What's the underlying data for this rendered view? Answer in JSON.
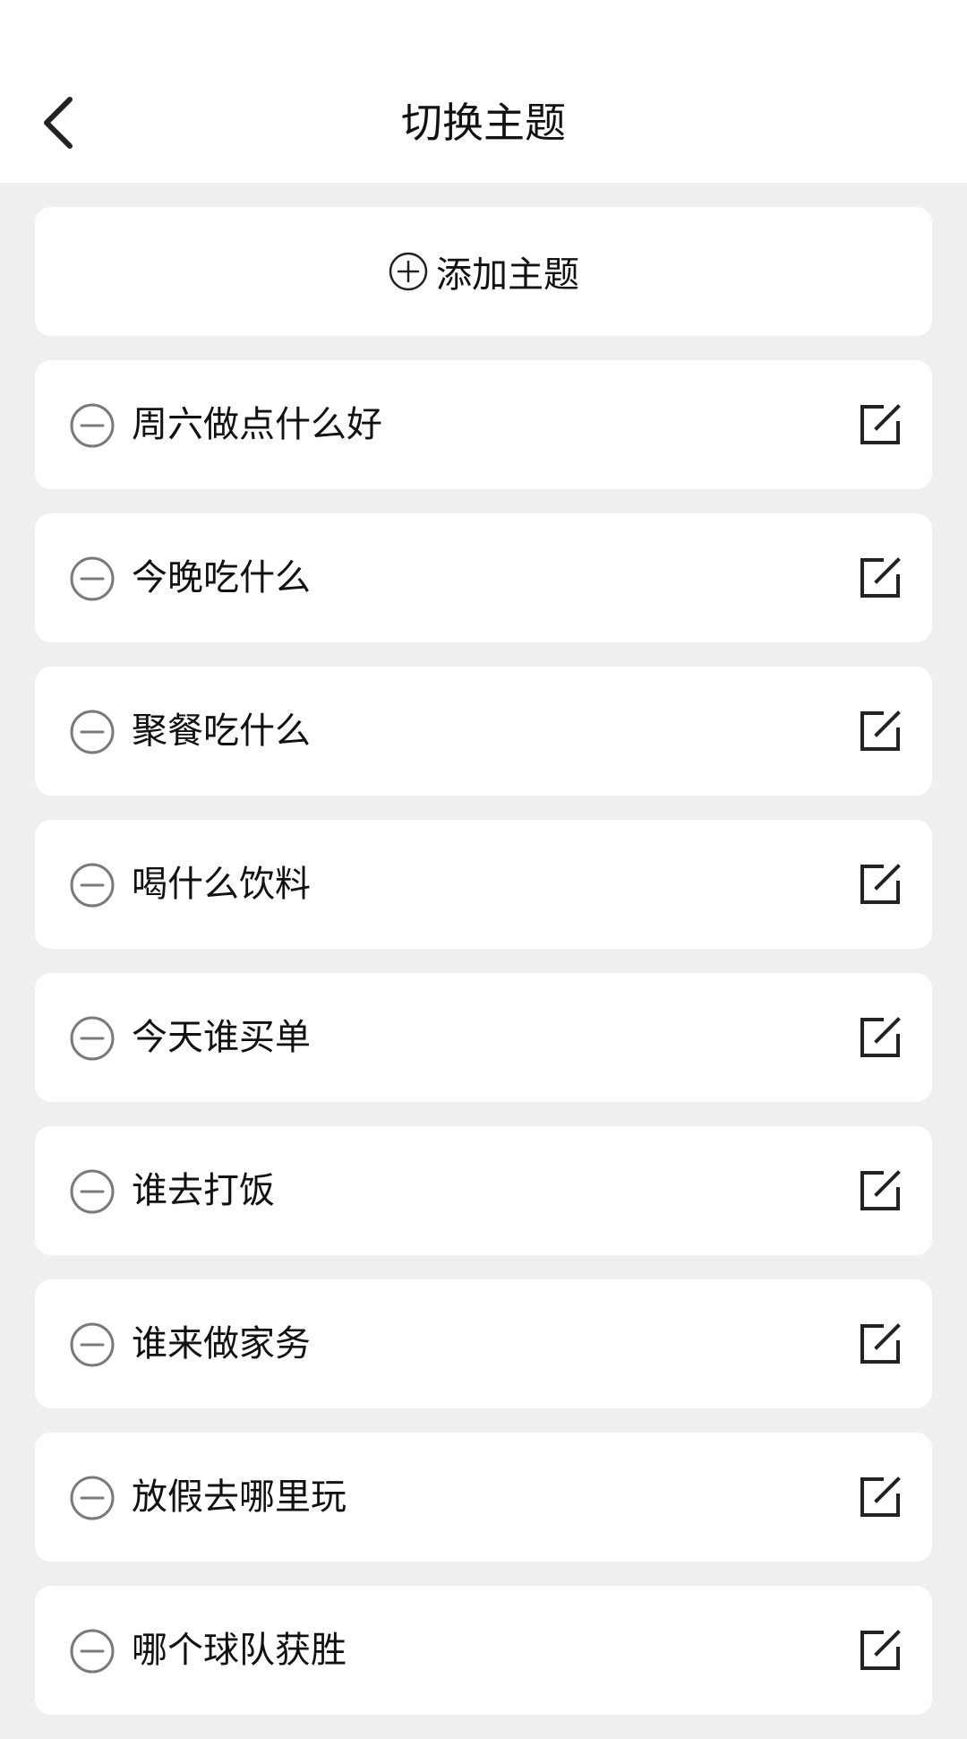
{
  "header": {
    "title": "切换主题",
    "back_icon": "chevron-left-icon"
  },
  "add_topic": {
    "label": "添加主题",
    "icon": "plus-circle-icon"
  },
  "topics": [
    {
      "label": "周六做点什么好"
    },
    {
      "label": "今晚吃什么"
    },
    {
      "label": "聚餐吃什么"
    },
    {
      "label": "喝什么饮料"
    },
    {
      "label": "今天谁买单"
    },
    {
      "label": "谁去打饭"
    },
    {
      "label": "谁来做家务"
    },
    {
      "label": "放假去哪里玩"
    },
    {
      "label": "哪个球队获胜"
    }
  ],
  "icons": {
    "remove": "minus-circle-icon",
    "edit": "edit-icon"
  },
  "colors": {
    "background": "#efefef",
    "card": "#ffffff",
    "text": "#111111",
    "icon_gray": "#7a7a7a",
    "icon_dark": "#222222"
  }
}
